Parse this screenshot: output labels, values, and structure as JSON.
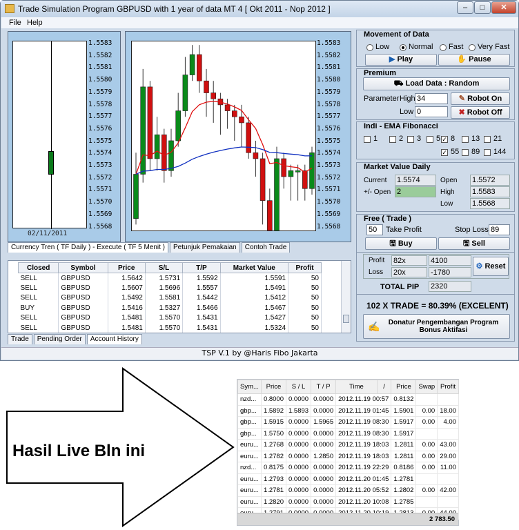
{
  "window": {
    "title": "Trade Simulation Program GBPUSD with 1 year of data  MT 4  [ Okt 2011 - Nop 2012 ]"
  },
  "menu": [
    "File",
    "Help"
  ],
  "left_chart": {
    "date_label": "02/11/2011"
  },
  "price_axis": [
    "1.5583",
    "1.5582",
    "1.5581",
    "1.5580",
    "1.5579",
    "1.5578",
    "1.5577",
    "1.5576",
    "1.5575",
    "1.5574",
    "1.5573",
    "1.5572",
    "1.5571",
    "1.5570",
    "1.5569",
    "1.5568"
  ],
  "chart_tabs": [
    "Currency Tren ( TF Daily ) - Execute ( TF 5 Menit )",
    "Petunjuk Pemakaian",
    "Contoh Trade"
  ],
  "trades": {
    "headers": [
      "Closed",
      "Symbol",
      "Price",
      "S/L",
      "T/P",
      "Market Value",
      "Profit"
    ],
    "rows": [
      [
        "SELL",
        "GBPUSD",
        "1.5642",
        "1.5731",
        "1.5592",
        "1.5591",
        "50"
      ],
      [
        "SELL",
        "GBPUSD",
        "1.5607",
        "1.5696",
        "1.5557",
        "1.5491",
        "50"
      ],
      [
        "SELL",
        "GBPUSD",
        "1.5492",
        "1.5581",
        "1.5442",
        "1.5412",
        "50"
      ],
      [
        "BUY",
        "GBPUSD",
        "1.5416",
        "1.5327",
        "1.5466",
        "1.5467",
        "50"
      ],
      [
        "SELL",
        "GBPUSD",
        "1.5481",
        "1.5570",
        "1.5431",
        "1.5427",
        "50"
      ],
      [
        "SELL",
        "GBPUSD",
        "1.5481",
        "1.5570",
        "1.5431",
        "1.5324",
        "50"
      ]
    ]
  },
  "trade_tabs": [
    "Trade",
    "Pending Order",
    "Account History"
  ],
  "movement": {
    "title": "Movement of Data",
    "speeds": [
      "Low",
      "Normal",
      "Fast",
      "Very Fast"
    ],
    "selected": "Normal",
    "play": "Play",
    "pause": "Pause"
  },
  "premium": {
    "title": "Premium",
    "load": "Load Data   : Random",
    "param": "Parameter",
    "high_label": "High",
    "high_value": "34",
    "low_label": "Low",
    "low_value": "0",
    "robot_on": "Robot On",
    "robot_off": "Robot Off"
  },
  "indi": {
    "title": "Indi - EMA Fibonacci",
    "options": [
      {
        "label": "1",
        "checked": false
      },
      {
        "label": "2",
        "checked": false
      },
      {
        "label": "3",
        "checked": false
      },
      {
        "label": "5",
        "checked": false
      },
      {
        "label": "8",
        "checked": true
      },
      {
        "label": "13",
        "checked": false
      },
      {
        "label": "21",
        "checked": false
      },
      {
        "label": "55",
        "checked": true
      },
      {
        "label": "89",
        "checked": false
      },
      {
        "label": "144",
        "checked": false
      }
    ]
  },
  "market": {
    "title": "Market Value Daily",
    "current_label": "Current",
    "current": "1.5574",
    "pm_label": "+/- Open",
    "pm": "2",
    "open_label": "Open",
    "open": "1.5572",
    "high_label": "High",
    "high": "1.5583",
    "low_label": "Low",
    "low": "1.5568"
  },
  "free": {
    "title": "Free ( Trade )",
    "tp_value": "50",
    "tp_label": "Take Profit",
    "sl_label": "Stop Loss",
    "sl_value": "89",
    "buy": "Buy",
    "sell": "Sell"
  },
  "results": {
    "profit_label": "Profit",
    "profit_count": "82x",
    "profit_value": "4100",
    "loss_label": "Loss",
    "loss_count": "20x",
    "loss_value": "-1780",
    "reset": "Reset",
    "total_label": "TOTAL PIP",
    "total": "2320",
    "summary": "102 X TRADE = 80.39% (EXCELENT)",
    "donate": "Donatur Pengembangan Program\nBonus Aktifasi"
  },
  "status": "TSP V.1 by @Haris Fibo Jakarta",
  "arrow_text": "Hasil  Live Bln ini",
  "history": {
    "headers": [
      "Sym...",
      "Price",
      "S / L",
      "T / P",
      "Time",
      "/",
      "Price",
      "Swap",
      "Profit"
    ],
    "rows": [
      [
        "nzd...",
        "0.8000",
        "0.0000",
        "0.0000",
        "2012.11.19 00:57",
        "0.8132",
        "",
        ""
      ],
      [
        "gbp...",
        "1.5892",
        "1.5893",
        "0.0000",
        "2012.11.19 01:45",
        "1.5901",
        "0.00",
        "18.00"
      ],
      [
        "gbp...",
        "1.5915",
        "0.0000",
        "1.5965",
        "2012.11.19 08:30",
        "1.5917",
        "0.00",
        "4.00"
      ],
      [
        "gbp...",
        "1.5750",
        "0.0000",
        "0.0000",
        "2012.11.19 08:30",
        "1.5917",
        "",
        ""
      ],
      [
        "euru...",
        "1.2768",
        "0.0000",
        "0.0000",
        "2012.11.19 18:03",
        "1.2811",
        "0.00",
        "43.00"
      ],
      [
        "euru...",
        "1.2782",
        "0.0000",
        "1.2850",
        "2012.11.19 18:03",
        "1.2811",
        "0.00",
        "29.00"
      ],
      [
        "nzd...",
        "0.8175",
        "0.0000",
        "0.0000",
        "2012.11.19 22:29",
        "0.8186",
        "0.00",
        "11.00"
      ],
      [
        "euru...",
        "1.2793",
        "0.0000",
        "0.0000",
        "2012.11.20 01:45",
        "1.2781",
        "",
        ""
      ],
      [
        "euru...",
        "1.2781",
        "0.0000",
        "0.0000",
        "2012.11.20 05:52",
        "1.2802",
        "0.00",
        "42.00"
      ],
      [
        "euru...",
        "1.2820",
        "0.0000",
        "0.0000",
        "2012.11.20 10:08",
        "1.2785",
        "",
        ""
      ],
      [
        "euru...",
        "1.2791",
        "0.0000",
        "0.0000",
        "2012.11.20 10:19",
        "1.2813",
        "0.00",
        "44.00"
      ]
    ],
    "total": "2 783.50"
  }
}
